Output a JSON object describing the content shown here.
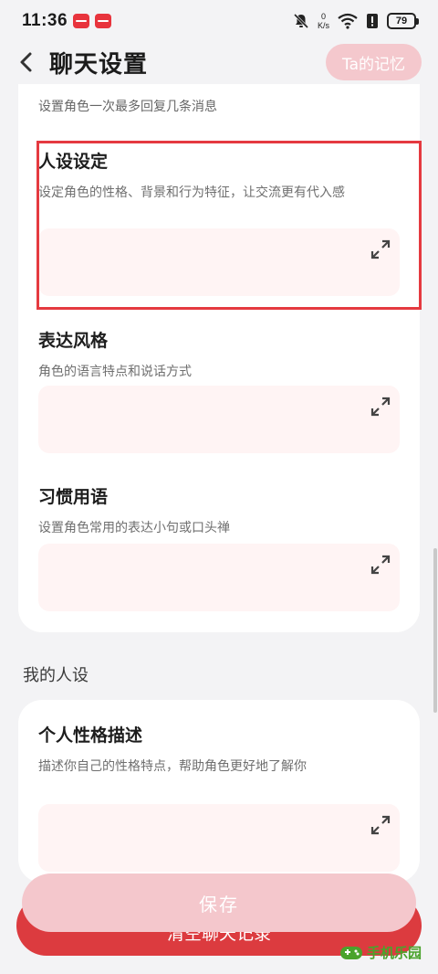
{
  "status": {
    "time": "11:36",
    "net_speed_value": "0",
    "net_speed_unit": "K/s",
    "battery": "79"
  },
  "header": {
    "title": "聊天设置",
    "memory_button": "Ta的记忆"
  },
  "character": {
    "reply_hint": "设置角色一次最多回复几条消息",
    "persona": {
      "title": "人设设定",
      "desc": "设定角色的性格、背景和行为特征，让交流更有代入感",
      "value": ""
    },
    "style": {
      "title": "表达风格",
      "desc": "角色的语言特点和说话方式",
      "value": ""
    },
    "phrases": {
      "title": "习惯用语",
      "desc": "设置角色常用的表达小句或口头禅",
      "value": ""
    }
  },
  "my_persona": {
    "section_label": "我的人设",
    "personality": {
      "title": "个人性格描述",
      "desc": "描述你自己的性格特点，帮助角色更好地了解你",
      "value": ""
    }
  },
  "buttons": {
    "save": "保存",
    "clear": "清空聊天记录"
  },
  "watermark": {
    "text": "手机乐园"
  },
  "colors": {
    "accent": "#dc3b3f",
    "accent_light": "#f4c7cc",
    "input_bg": "#fff4f4",
    "highlight": "#e53a40"
  },
  "icons": [
    "back-arrow-icon",
    "expand-icon",
    "mute-bell-icon",
    "wifi-icon",
    "alert-icon",
    "battery-icon"
  ]
}
